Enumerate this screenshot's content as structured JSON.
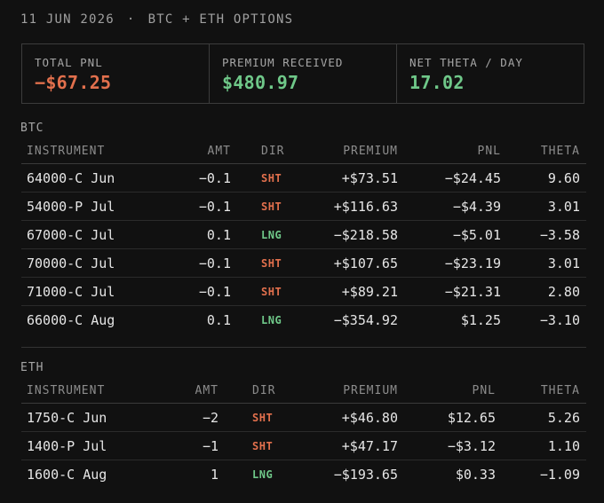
{
  "header": {
    "date": "11 JUN 2026",
    "separator": "·",
    "title": "BTC + ETH OPTIONS"
  },
  "summary": [
    {
      "label": "TOTAL PNL",
      "value": "−$67.25",
      "tone": "neg"
    },
    {
      "label": "PREMIUM RECEIVED",
      "value": "$480.97",
      "tone": "pos"
    },
    {
      "label": "NET THETA / DAY",
      "value": "17.02",
      "tone": "pos"
    }
  ],
  "columns": {
    "instrument": "INSTRUMENT",
    "amt": "AMT",
    "dir": "DIR",
    "premium": "PREMIUM",
    "pnl": "PNL",
    "theta": "THETA"
  },
  "btc": {
    "label": "BTC",
    "rows": [
      {
        "instrument": "64000-C Jun",
        "amt": "−0.1",
        "dir": "SHT",
        "premium": "+$73.51",
        "pnl": "−$24.45",
        "theta": "9.60"
      },
      {
        "instrument": "54000-P Jul",
        "amt": "−0.1",
        "dir": "SHT",
        "premium": "+$116.63",
        "pnl": "−$4.39",
        "theta": "3.01"
      },
      {
        "instrument": "67000-C Jul",
        "amt": "0.1",
        "dir": "LNG",
        "premium": "−$218.58",
        "pnl": "−$5.01",
        "theta": "−3.58"
      },
      {
        "instrument": "70000-C Jul",
        "amt": "−0.1",
        "dir": "SHT",
        "premium": "+$107.65",
        "pnl": "−$23.19",
        "theta": "3.01"
      },
      {
        "instrument": "71000-C Jul",
        "amt": "−0.1",
        "dir": "SHT",
        "premium": "+$89.21",
        "pnl": "−$21.31",
        "theta": "2.80"
      },
      {
        "instrument": "66000-C Aug",
        "amt": "0.1",
        "dir": "LNG",
        "premium": "−$354.92",
        "pnl": "$1.25",
        "theta": "−3.10"
      }
    ]
  },
  "eth": {
    "label": "ETH",
    "rows": [
      {
        "instrument": "1750-C Jun",
        "amt": "−2",
        "dir": "SHT",
        "premium": "+$46.80",
        "pnl": "$12.65",
        "theta": "5.26"
      },
      {
        "instrument": "1400-P Jul",
        "amt": "−1",
        "dir": "SHT",
        "premium": "+$47.17",
        "pnl": "−$3.12",
        "theta": "1.10"
      },
      {
        "instrument": "1600-C Aug",
        "amt": "1",
        "dir": "LNG",
        "premium": "−$193.65",
        "pnl": "$0.33",
        "theta": "−1.09"
      }
    ]
  }
}
